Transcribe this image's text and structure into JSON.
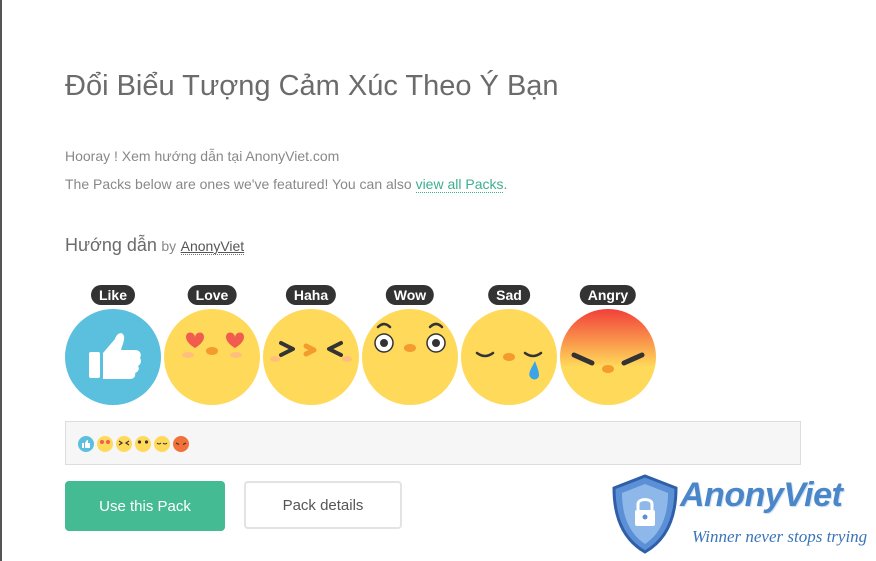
{
  "title": "Đổi Biểu Tượng Cảm Xúc Theo Ý Bạn",
  "intro": {
    "line1": "Hooray ! Xem hướng dẫn tại AnonyViet.com",
    "line2_prefix": "The Packs below are ones we've featured! You can also ",
    "link_text": "view all Packs",
    "line2_suffix": "."
  },
  "pack": {
    "name": "Hướng dẫn",
    "by": "by",
    "author": "AnonyViet"
  },
  "reactions": [
    "Like",
    "Love",
    "Haha",
    "Wow",
    "Sad",
    "Angry"
  ],
  "buttons": {
    "use": "Use this Pack",
    "details": "Pack details"
  },
  "logo": {
    "brand": "AnonyViet",
    "slogan": "Winner never stops trying"
  },
  "colors": {
    "accent": "#45bb93",
    "like_blue": "#5bc0de",
    "emoji_yellow": "#ffd95a"
  }
}
